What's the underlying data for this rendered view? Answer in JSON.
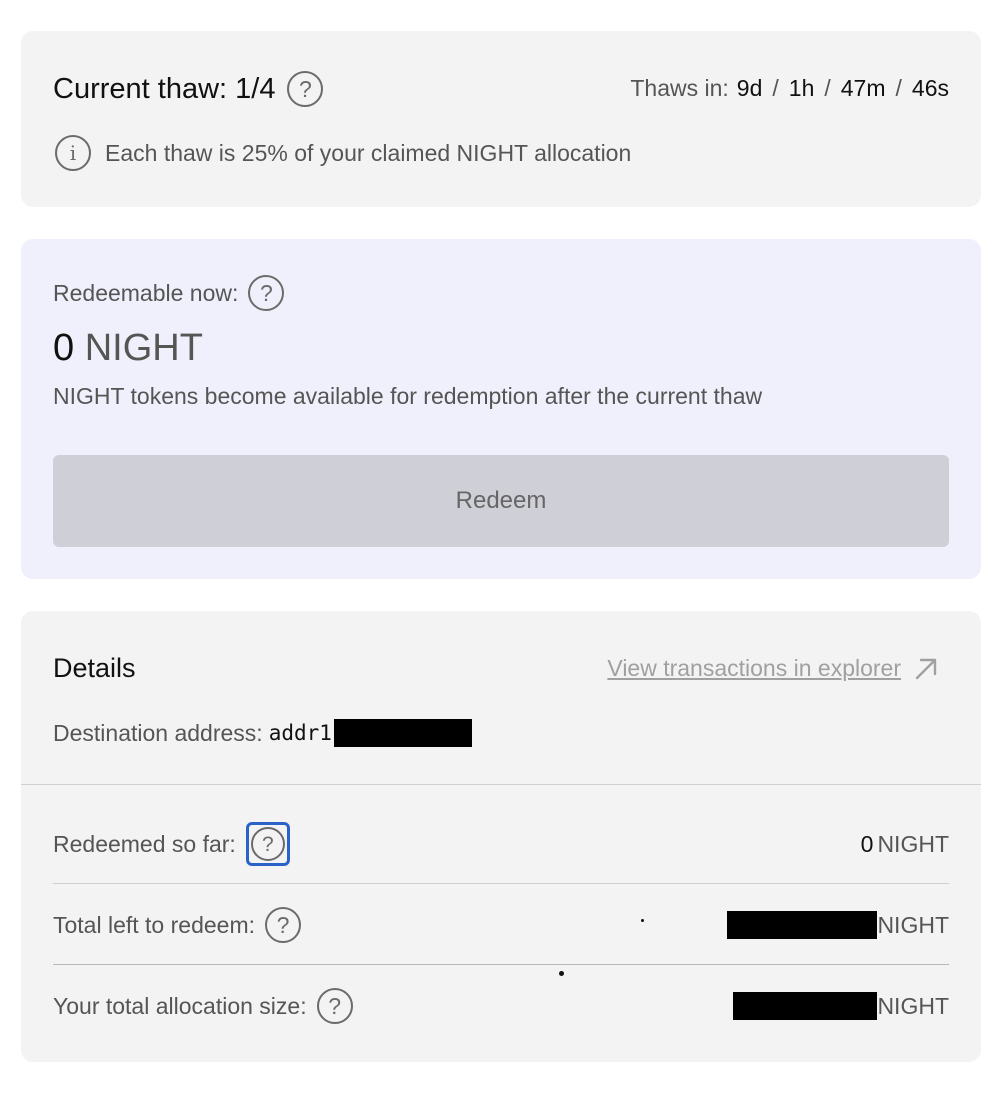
{
  "thaw": {
    "title": "Current thaw: 1/4",
    "help_icon": "question-circle-icon",
    "thaws_in_label": "Thaws in:",
    "countdown": {
      "days": "9d",
      "hours": "1h",
      "minutes": "47m",
      "seconds": "46s"
    },
    "separator": "/",
    "info_icon": "info-circle-icon",
    "info_text": "Each thaw is 25% of your claimed NIGHT allocation"
  },
  "redeem": {
    "label": "Redeemable now:",
    "amount": "0",
    "unit": "NIGHT",
    "description": "NIGHT tokens become available for redemption after the current thaw",
    "button_label": "Redeem"
  },
  "details": {
    "title": "Details",
    "explorer_link": "View transactions in explorer",
    "explorer_icon": "arrow-up-right-icon",
    "destination_label": "Destination address:",
    "destination_prefix": "addr1",
    "rows": [
      {
        "label": "Redeemed so far:",
        "value": "0",
        "unit": "NIGHT"
      },
      {
        "label": "Total left to redeem:",
        "value": "",
        "unit": "NIGHT"
      },
      {
        "label": "Your total allocation size:",
        "value": "",
        "unit": "NIGHT"
      }
    ]
  },
  "colors": {
    "card_gray": "#f3f3f3",
    "card_lavender": "#f0f0fc",
    "button_disabled": "#cfcfd8",
    "focus_ring": "#2a62c9",
    "link_muted": "#a0a0a0"
  }
}
